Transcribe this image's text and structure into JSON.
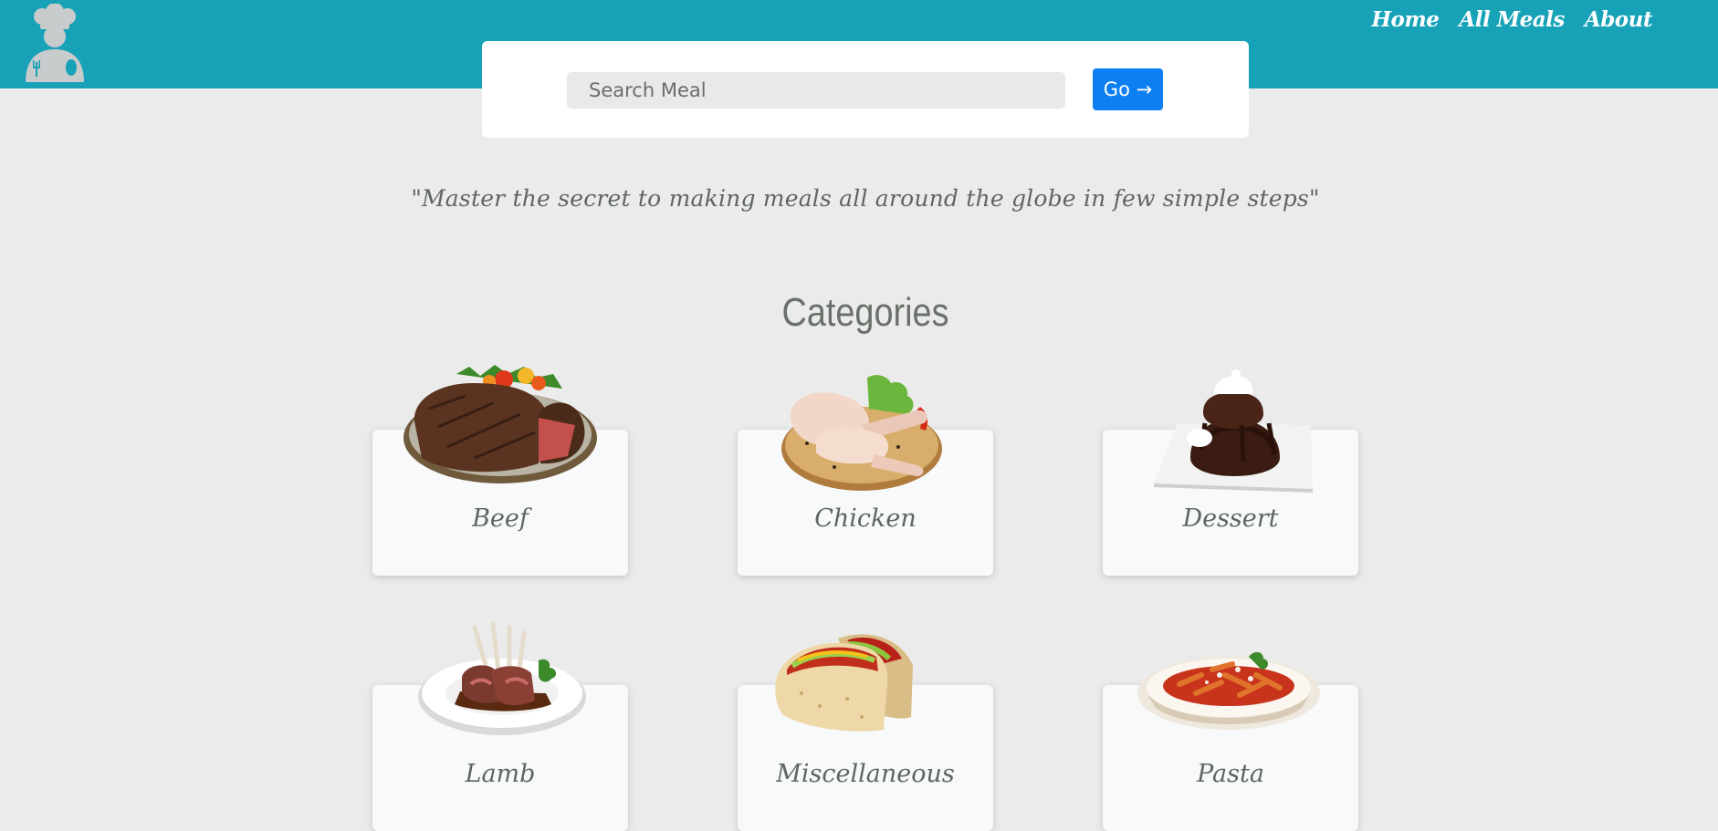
{
  "nav": {
    "items": [
      "Home",
      "All Meals",
      "About"
    ]
  },
  "search": {
    "placeholder": "Search Meal",
    "button_label": "Go →"
  },
  "tagline": "\"Master the secret to making meals all around the globe in few simple steps\"",
  "categories": {
    "title": "Categories",
    "items": [
      {
        "label": "Beef",
        "icon": "beef-steak-image"
      },
      {
        "label": "Chicken",
        "icon": "chicken-legs-image"
      },
      {
        "label": "Dessert",
        "icon": "chocolate-cake-image"
      },
      {
        "label": "Lamb",
        "icon": "lamb-chops-image"
      },
      {
        "label": "Miscellaneous",
        "icon": "tacos-image"
      },
      {
        "label": "Pasta",
        "icon": "pasta-bowl-image"
      }
    ]
  },
  "colors": {
    "header": "#17a2b8",
    "page_bg": "#ebebeb",
    "button": "#0d7ff3",
    "muted_text": "#5f665f"
  }
}
